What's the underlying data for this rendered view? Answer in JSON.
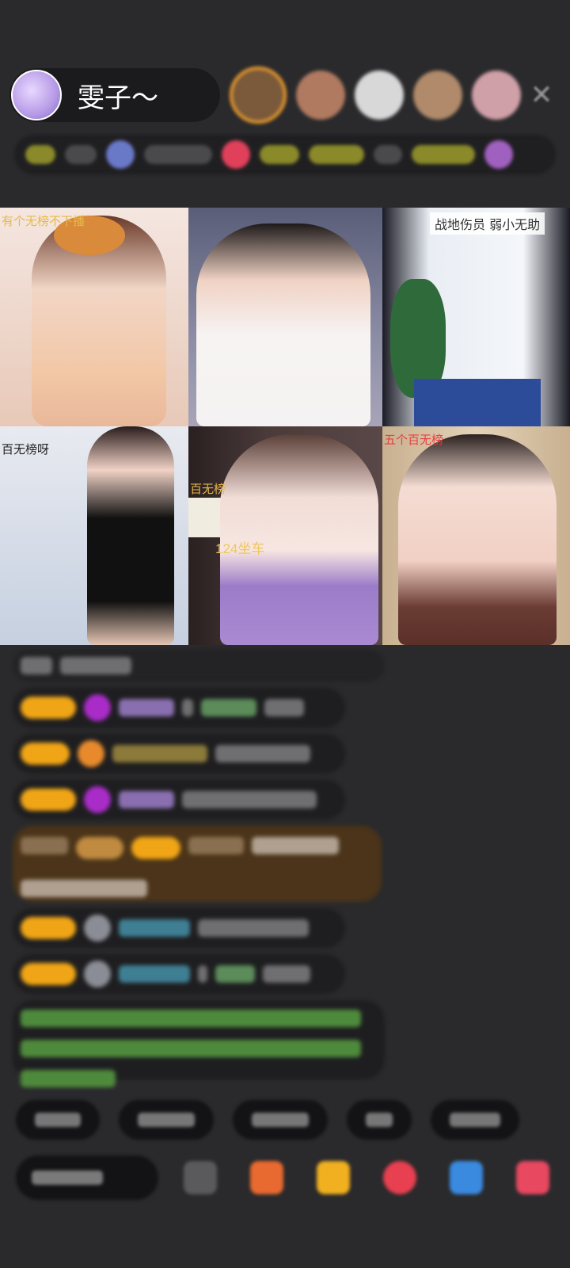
{
  "host": {
    "name": "雯子～"
  },
  "grid": {
    "tiles": [
      {
        "tag": "有个无榜不下播",
        "subtitle": ""
      },
      {
        "tag": "",
        "subtitle": ""
      },
      {
        "tag": "战地伤员 弱小无助",
        "subtitle": ""
      },
      {
        "tag": "百无榜呀",
        "subtitle": ""
      },
      {
        "tag": "百无榜",
        "subtitle": "124坐车"
      },
      {
        "tag": "五个百无榜",
        "subtitle": ""
      }
    ]
  },
  "colors": {
    "background": "#2a2a2c",
    "badge": "#f0a516",
    "highlight_message": "#4b3419"
  },
  "icons": [
    "close-icon",
    "gift-icon",
    "shop-icon",
    "heart-icon",
    "game-icon",
    "menu-icon"
  ]
}
